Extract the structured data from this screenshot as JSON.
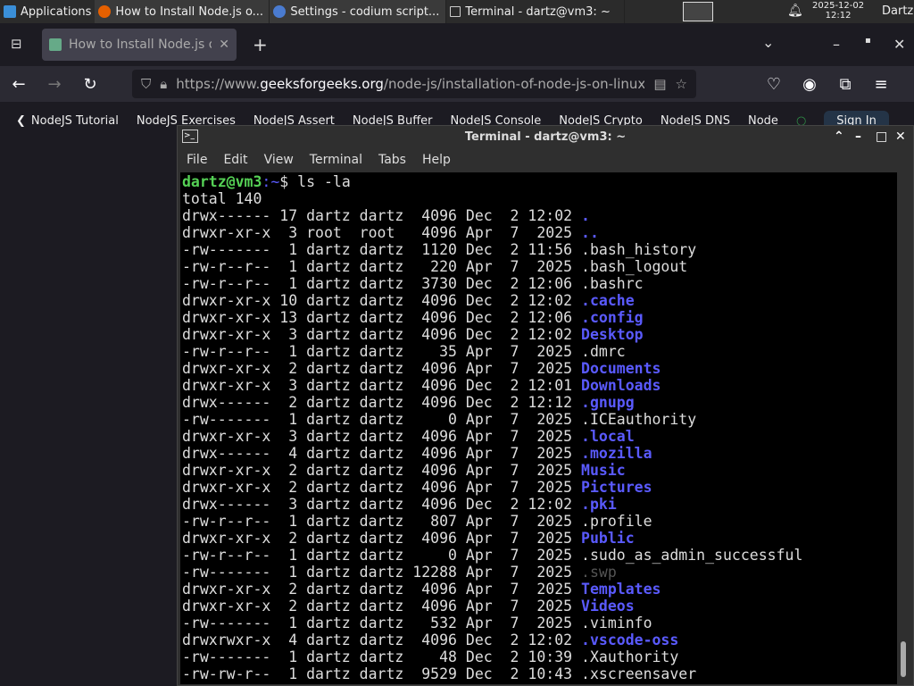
{
  "taskbar": {
    "apps_label": "Applications",
    "windows": [
      "How to Install Node.js o...",
      "Settings - codium script...",
      "Terminal - dartz@vm3: ~"
    ],
    "date": "2025-12-02",
    "time": "12:12",
    "user": "Dartz"
  },
  "browser": {
    "tab_title": "How to Install Node.js on",
    "url_prefix": "https://www.",
    "url_domain": "geeksforgeeks.org",
    "url_path": "/node-js/installation-of-node-js-on-linux/",
    "bookmarks": [
      "NodeJS Tutorial",
      "NodeJS Exercises",
      "NodeJS Assert",
      "NodeJS Buffer",
      "NodeJS Console",
      "NodeJS Crypto",
      "NodeJS DNS",
      "Node"
    ],
    "sign_in": "Sign In"
  },
  "terminal": {
    "title": "Terminal - dartz@vm3: ~",
    "menu": [
      "File",
      "Edit",
      "View",
      "Terminal",
      "Tabs",
      "Help"
    ],
    "prompt_user": "dartz@vm3",
    "prompt_path": ":~",
    "prompt_sym": "$ ",
    "command": "ls -la",
    "total": "total 140",
    "colors": {
      "prompt": "#55d155",
      "dir": "#5a5aff"
    },
    "entries": [
      [
        "drwx------ 17 dartz dartz  4096 Dec  2 12:02 ",
        ".",
        "dir"
      ],
      [
        "drwxr-xr-x  3 root  root   4096 Apr  7  2025 ",
        "..",
        "dir"
      ],
      [
        "-rw-------  1 dartz dartz  1120 Dec  2 11:56 ",
        ".bash_history",
        "file"
      ],
      [
        "-rw-r--r--  1 dartz dartz   220 Apr  7  2025 ",
        ".bash_logout",
        "file"
      ],
      [
        "-rw-r--r--  1 dartz dartz  3730 Dec  2 12:06 ",
        ".bashrc",
        "file"
      ],
      [
        "drwxr-xr-x 10 dartz dartz  4096 Dec  2 12:02 ",
        ".cache",
        "dir"
      ],
      [
        "drwxr-xr-x 13 dartz dartz  4096 Dec  2 12:06 ",
        ".config",
        "dir"
      ],
      [
        "drwxr-xr-x  3 dartz dartz  4096 Dec  2 12:02 ",
        "Desktop",
        "dir"
      ],
      [
        "-rw-r--r--  1 dartz dartz    35 Apr  7  2025 ",
        ".dmrc",
        "file"
      ],
      [
        "drwxr-xr-x  2 dartz dartz  4096 Apr  7  2025 ",
        "Documents",
        "dir"
      ],
      [
        "drwxr-xr-x  3 dartz dartz  4096 Dec  2 12:01 ",
        "Downloads",
        "dir"
      ],
      [
        "drwx------  2 dartz dartz  4096 Dec  2 12:12 ",
        ".gnupg",
        "dir"
      ],
      [
        "-rw-------  1 dartz dartz     0 Apr  7  2025 ",
        ".ICEauthority",
        "file"
      ],
      [
        "drwxr-xr-x  3 dartz dartz  4096 Apr  7  2025 ",
        ".local",
        "dir"
      ],
      [
        "drwx------  4 dartz dartz  4096 Apr  7  2025 ",
        ".mozilla",
        "dir"
      ],
      [
        "drwxr-xr-x  2 dartz dartz  4096 Apr  7  2025 ",
        "Music",
        "dir"
      ],
      [
        "drwxr-xr-x  2 dartz dartz  4096 Apr  7  2025 ",
        "Pictures",
        "dir"
      ],
      [
        "drwx------  3 dartz dartz  4096 Dec  2 12:02 ",
        ".pki",
        "dir"
      ],
      [
        "-rw-r--r--  1 dartz dartz   807 Apr  7  2025 ",
        ".profile",
        "file"
      ],
      [
        "drwxr-xr-x  2 dartz dartz  4096 Apr  7  2025 ",
        "Public",
        "dir"
      ],
      [
        "-rw-r--r--  1 dartz dartz     0 Apr  7  2025 ",
        ".sudo_as_admin_successful",
        "file"
      ],
      [
        "-rw-------  1 dartz dartz 12288 Apr  7  2025 ",
        ".swp",
        "swap"
      ],
      [
        "drwxr-xr-x  2 dartz dartz  4096 Apr  7  2025 ",
        "Templates",
        "dir"
      ],
      [
        "drwxr-xr-x  2 dartz dartz  4096 Apr  7  2025 ",
        "Videos",
        "dir"
      ],
      [
        "-rw-------  1 dartz dartz   532 Apr  7  2025 ",
        ".viminfo",
        "file"
      ],
      [
        "drwxrwxr-x  4 dartz dartz  4096 Dec  2 12:02 ",
        ".vscode-oss",
        "dir"
      ],
      [
        "-rw-------  1 dartz dartz    48 Dec  2 10:39 ",
        ".Xauthority",
        "file"
      ],
      [
        "-rw-rw-r--  1 dartz dartz  9529 Dec  2 10:43 ",
        ".xscreensaver",
        "file"
      ]
    ]
  }
}
